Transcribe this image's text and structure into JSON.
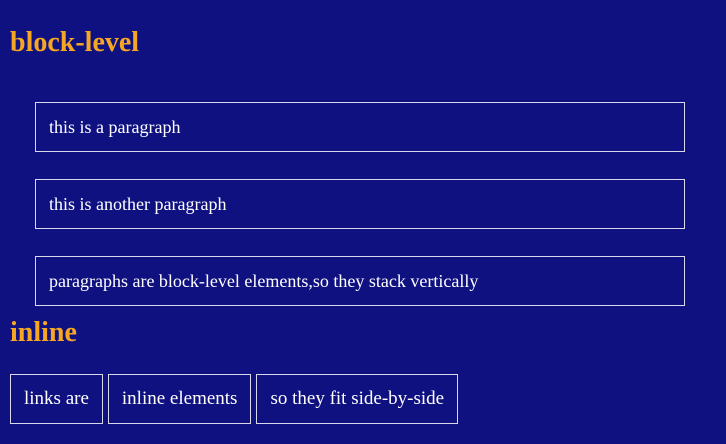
{
  "sections": {
    "block": {
      "heading": "block-level",
      "paragraphs": [
        "this is a paragraph",
        "this is another paragraph",
        "paragraphs are block-level elements,so they stack vertically"
      ]
    },
    "inline": {
      "heading": "inline",
      "links": [
        "links are",
        "inline elements",
        "so they fit side-by-side"
      ]
    }
  },
  "colors": {
    "background": "#0f1180",
    "heading": "#f5a623",
    "text": "#ffffff",
    "border": "#d8d8e8"
  }
}
